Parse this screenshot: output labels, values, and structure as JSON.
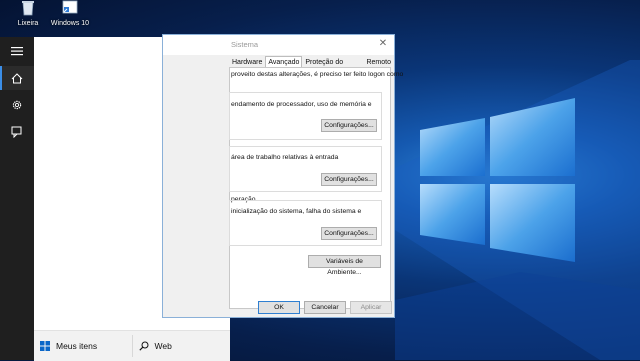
{
  "colors": {
    "accent": "#3b8ee8",
    "desktop": "#0a3577",
    "rail": "#1f1f1f"
  },
  "desktop_icons": [
    {
      "label": "Lixeira",
      "icon": "recycle-bin-icon"
    },
    {
      "label": "Windows 10",
      "icon": "shortcut-icon"
    }
  ],
  "start_menu": {
    "rail": [
      {
        "icon": "hamburger-menu-icon"
      },
      {
        "icon": "home-icon"
      },
      {
        "icon": "gear-icon"
      },
      {
        "icon": "feedback-icon"
      }
    ],
    "bottom": {
      "my_items": "Meus itens",
      "web": "Web"
    }
  },
  "dialog": {
    "title": "Sistema",
    "tabs": [
      "Hardware",
      "Avançado",
      "Proteção do Sistema",
      "Remoto"
    ],
    "active_tab": "Avançado",
    "intro_text": "proveito destas alterações, é preciso ter feito logon como",
    "section1_text": "endamento de processador, uso de memória e",
    "section2_text": "área de trabalho relativas à entrada",
    "section3_heading": "peração",
    "section3_text": "inicialização do sistema, falha do sistema e",
    "settings_button": "Configurações...",
    "env_button": "Variáveis de Ambiente...",
    "ok": "OK",
    "cancel": "Cancelar",
    "apply": "Aplicar"
  }
}
